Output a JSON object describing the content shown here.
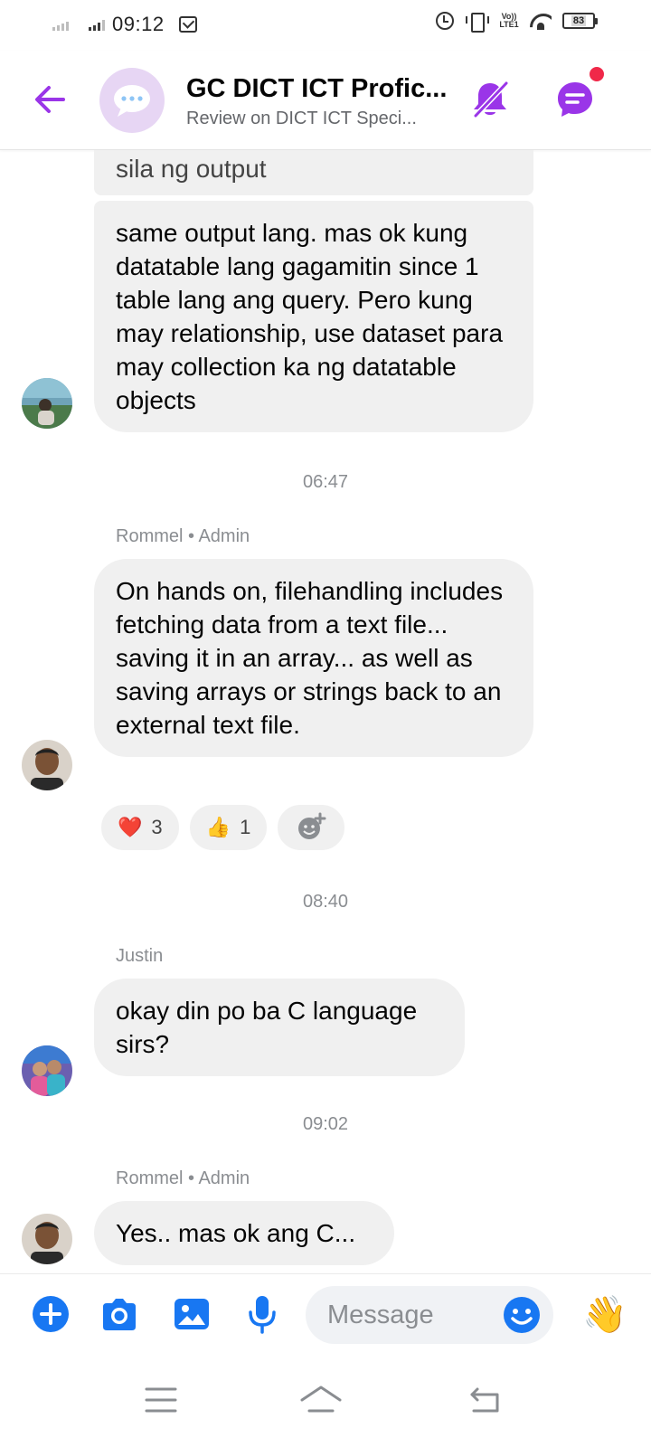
{
  "status_bar": {
    "time": "09:12",
    "battery": "83",
    "network": "Vo)) LTE1"
  },
  "header": {
    "title": "GC DICT ICT Profic...",
    "subtitle": "Review on DICT ICT Speci..."
  },
  "messages": [
    {
      "fragment_text": "sila ng output",
      "text": "same output lang. mas ok kung datatable lang gagamitin since 1 table lang ang query. Pero kung may relationship, use dataset para may collection ka ng datatable objects"
    },
    {
      "timestamp": "06:47",
      "sender": "Rommel • Admin",
      "text": "On hands on, filehandling includes fetching data from a text file... saving it in an array... as well as saving arrays or strings back to an external text file.",
      "reactions": [
        {
          "emoji": "❤️",
          "icon": "heart",
          "count": "3"
        },
        {
          "emoji": "👍",
          "icon": "thumbs-up",
          "count": "1"
        }
      ]
    },
    {
      "timestamp": "08:40",
      "sender": "Justin",
      "text": "okay din po ba C language sirs?"
    },
    {
      "timestamp": "09:02",
      "sender": "Rommel • Admin",
      "text": "Yes.. mas ok ang C..."
    }
  ],
  "composer": {
    "placeholder": "Message",
    "wave": "👋"
  },
  "colors": {
    "accent_purple": "#9a35e8",
    "messenger_blue": "#1877f2",
    "bubble_gray": "#f0f0f0",
    "notification_red": "#f02849"
  }
}
